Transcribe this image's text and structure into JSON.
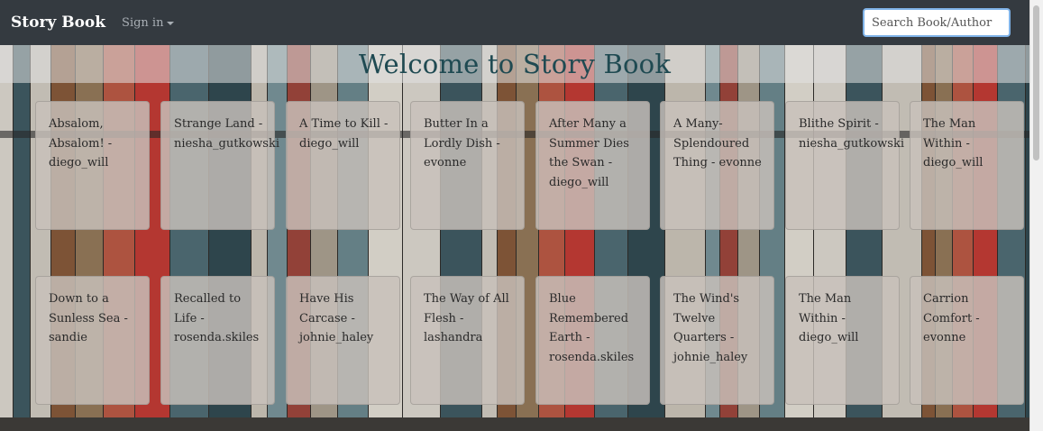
{
  "navbar": {
    "brand": "Story Book",
    "signin_label": "Sign in",
    "search_placeholder": "Search Book/Author",
    "search_value": ""
  },
  "header": {
    "title": "Welcome to Story Book"
  },
  "books": [
    {
      "title_author": "Absalom, Absalom! - diego_will"
    },
    {
      "title_author": "Strange Land - niesha_gutkowski"
    },
    {
      "title_author": "A Time to Kill - diego_will"
    },
    {
      "title_author": "Butter In a Lordly Dish - evonne"
    },
    {
      "title_author": "After Many a Summer Dies the Swan - diego_will"
    },
    {
      "title_author": "A Many-Splendoured Thing - evonne"
    },
    {
      "title_author": "Blithe Spirit - niesha_gutkowski"
    },
    {
      "title_author": "The Man Within - diego_will"
    },
    {
      "title_author": "Down to a Sunless Sea - sandie"
    },
    {
      "title_author": "Recalled to Life - rosenda.skiles"
    },
    {
      "title_author": "Have His Carcase - johnie_haley"
    },
    {
      "title_author": "The Way of All Flesh - lashandra"
    },
    {
      "title_author": "Blue Remembered Earth - rosenda.skiles"
    },
    {
      "title_author": "The Wind's Twelve Quarters - johnie_haley"
    },
    {
      "title_author": "The Man Within - diego_will"
    },
    {
      "title_author": "Carrion Comfort - evonne"
    }
  ],
  "colors": {
    "navbar": "#343a40",
    "title_text": "#1f4a52",
    "card_bg": "#c8c0ba"
  }
}
